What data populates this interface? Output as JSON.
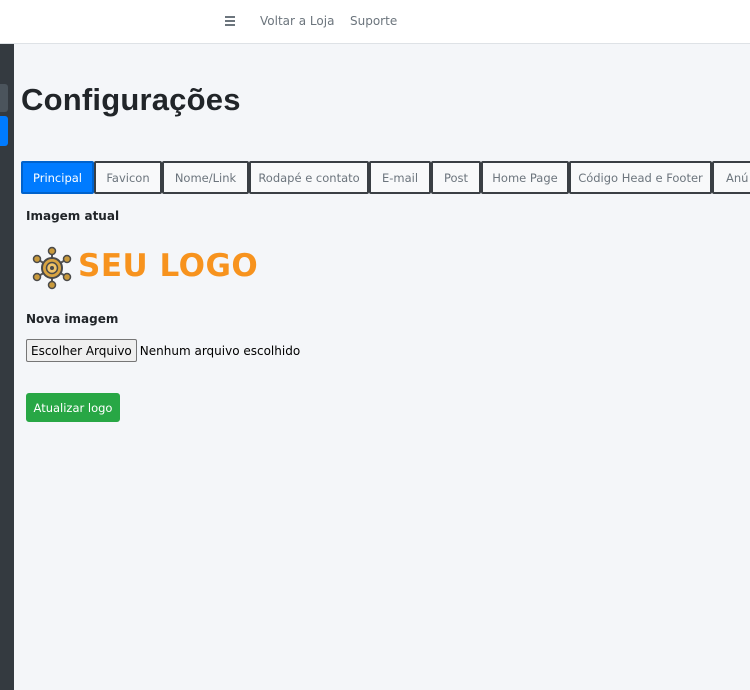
{
  "navbar": {
    "menu_icon": "hamburger-icon",
    "links": [
      "Voltar a Loja",
      "Suporte"
    ]
  },
  "page": {
    "title": "Configurações"
  },
  "tabs": [
    {
      "label": "Principal",
      "active": true
    },
    {
      "label": "Favicon"
    },
    {
      "label": "Nome/Link"
    },
    {
      "label": "Rodapé e contato"
    },
    {
      "label": "E-mail"
    },
    {
      "label": "Post"
    },
    {
      "label": "Home Page"
    },
    {
      "label": "Código Head e Footer"
    },
    {
      "label": "Anú"
    }
  ],
  "form": {
    "current_image_label": "Imagem atual",
    "logo_text": "SEU LOGO",
    "new_image_label": "Nova imagem",
    "file_button": "Escolher Arquivo",
    "file_status": "Nenhum arquivo escolhido",
    "submit": "Atualizar logo"
  },
  "colors": {
    "primary": "#007bff",
    "success": "#28a745",
    "logo_orange": "#f7931e",
    "sidebar": "#343a40"
  }
}
